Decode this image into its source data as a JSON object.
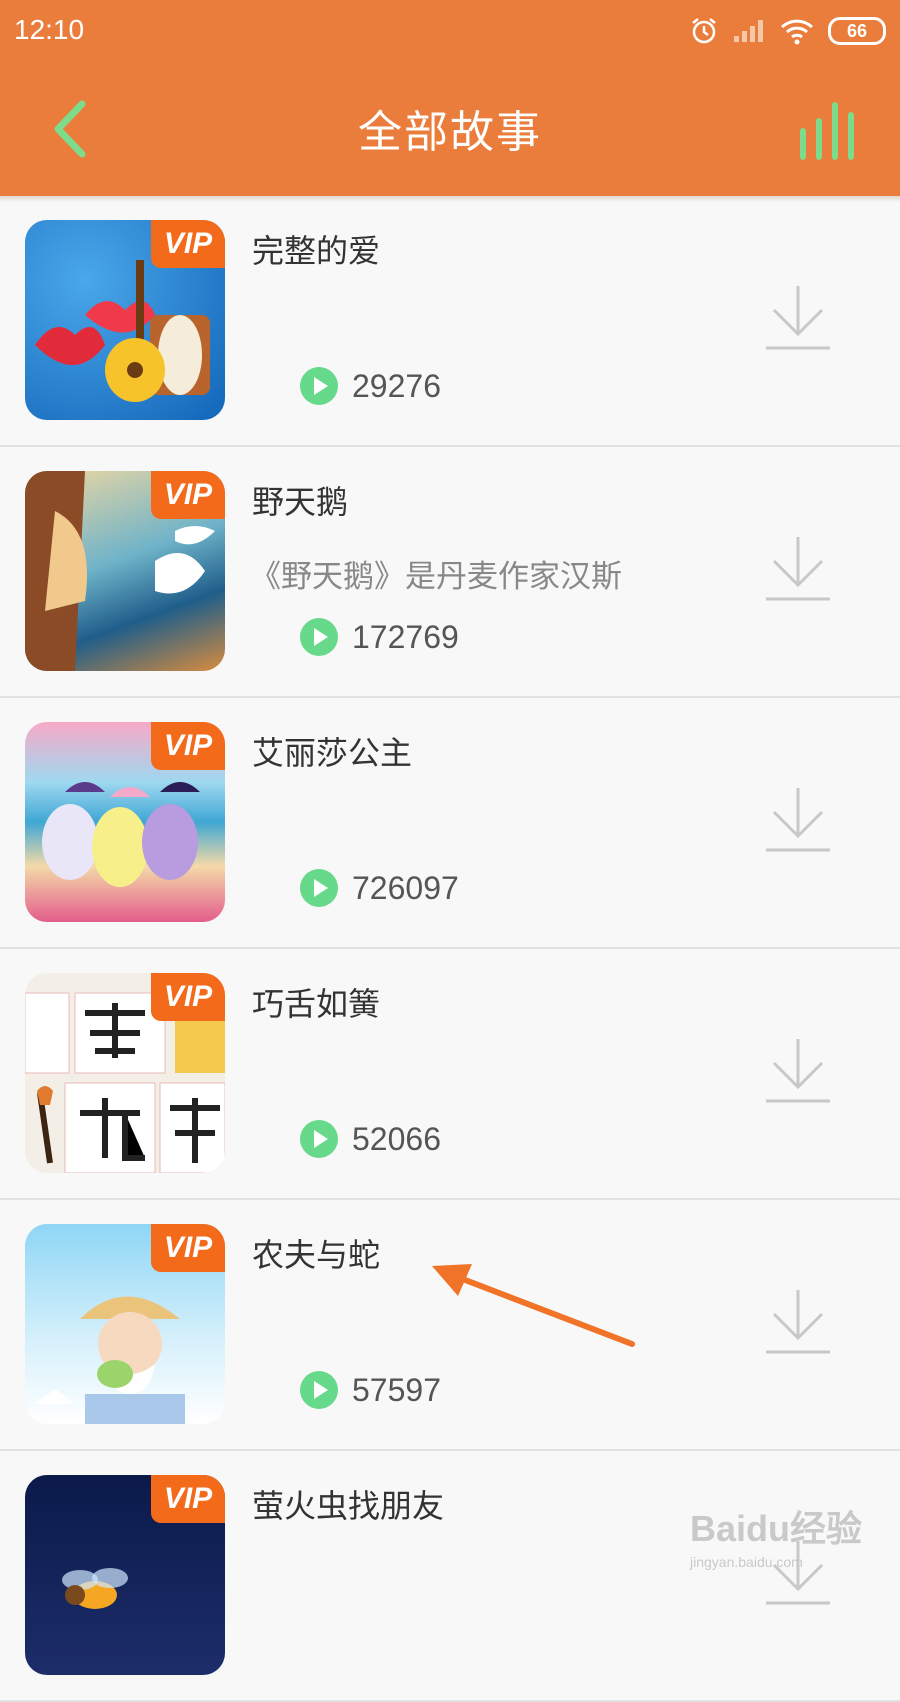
{
  "status_bar": {
    "time": "12:10",
    "battery": "66"
  },
  "header": {
    "title": "全部故事",
    "colors": {
      "background": "#eb7d3c",
      "accent": "#7ddc8c"
    }
  },
  "stories": [
    {
      "title": "完整的爱",
      "description": "",
      "badge": "VIP",
      "plays": "29276"
    },
    {
      "title": "野天鹅",
      "description": "《野天鹅》是丹麦作家汉斯",
      "badge": "VIP",
      "plays": "172769"
    },
    {
      "title": "艾丽莎公主",
      "description": "",
      "badge": "VIP",
      "plays": "726097"
    },
    {
      "title": "巧舌如簧",
      "description": "",
      "badge": "VIP",
      "plays": "52066"
    },
    {
      "title": "农夫与蛇",
      "description": "",
      "badge": "VIP",
      "plays": "57597"
    },
    {
      "title": "萤火虫找朋友",
      "description": "",
      "badge": "VIP",
      "plays": ""
    }
  ],
  "watermark": {
    "brand": "Baidu经验",
    "url": "jingyan.baidu.com"
  }
}
